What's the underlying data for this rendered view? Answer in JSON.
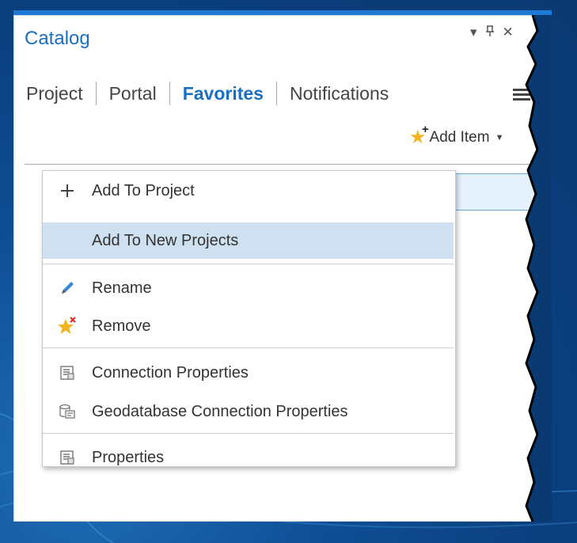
{
  "panel": {
    "title": "Catalog",
    "window_controls": {
      "dropdown_glyph": "▾",
      "pin_glyph": "⊥",
      "close_glyph": "✕"
    },
    "tabs": [
      {
        "label": "Project"
      },
      {
        "label": "Portal"
      },
      {
        "label": "Favorites",
        "active": true
      },
      {
        "label": "Notifications"
      }
    ],
    "add_item_label": "Add Item",
    "accent_color": "#1a6fbf"
  },
  "context_menu": {
    "items": [
      {
        "label": "Add To Project",
        "icon": "plus-icon"
      },
      {
        "label": "Add To New Projects",
        "icon": "none",
        "highlighted": true
      },
      {
        "label": "Rename",
        "icon": "pencil-icon"
      },
      {
        "label": "Remove",
        "icon": "star-remove-icon"
      },
      {
        "label": "Connection Properties",
        "icon": "properties-icon"
      },
      {
        "label": "Geodatabase Connection Properties",
        "icon": "geodatabase-icon"
      },
      {
        "label": "Properties",
        "icon": "properties-icon"
      }
    ]
  }
}
